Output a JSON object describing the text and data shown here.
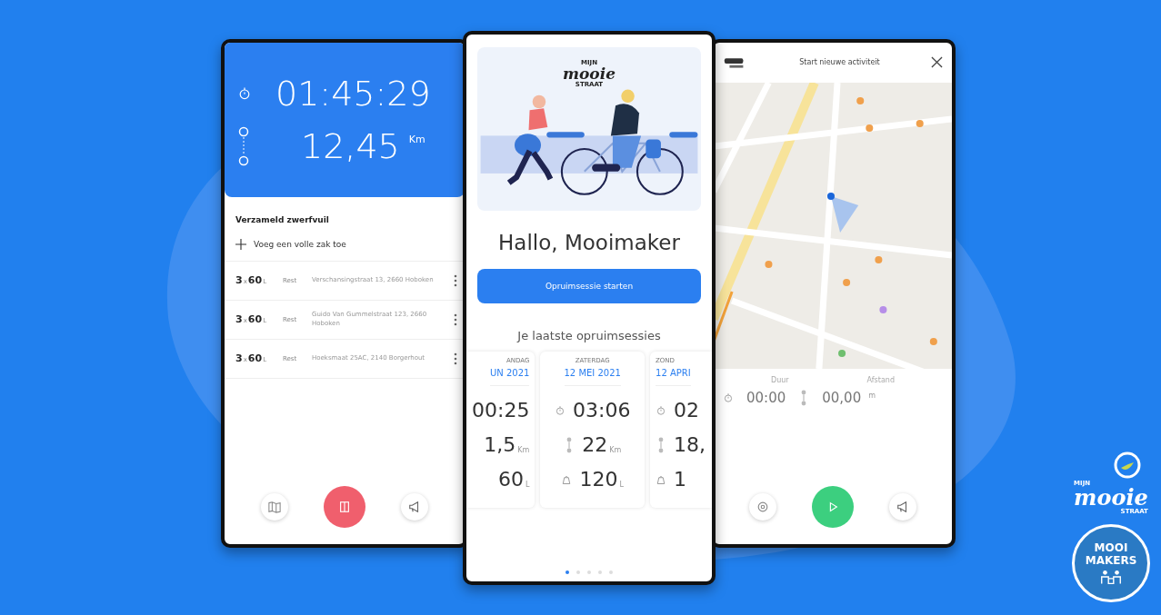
{
  "tracking_screen": {
    "duration": "01:45:29",
    "distance": "12,45",
    "distance_unit": "Km",
    "section_title": "Verzameld zwerfvuil",
    "add_label": "Voeg een volle zak toe",
    "bags": [
      {
        "count": "3",
        "times": "x",
        "volume": "60",
        "unit": "L",
        "type": "Rest",
        "address": "Verschansingstraat 13, 2660 Hoboken"
      },
      {
        "count": "3",
        "times": "x",
        "volume": "60",
        "unit": "L",
        "type": "Rest",
        "address": "Guido Van Gummelstraat 123, 2660 Hoboken"
      },
      {
        "count": "3",
        "times": "x",
        "volume": "60",
        "unit": "L",
        "type": "Rest",
        "address": "Hoeksmaat 25AC, 2140 Borgerhout"
      }
    ]
  },
  "home_screen": {
    "logo": {
      "top": "MIJN",
      "main": "mooie",
      "bottom": "STRAAT"
    },
    "greeting": "Hallo, Mooimaker",
    "start_button": "Opruimsessie starten",
    "sessions_title": "Je laatste opruimsessies",
    "sessions": [
      {
        "weekday": "ANDAG",
        "date": "UN 2021",
        "duration": "00:25",
        "distance": "1,5",
        "distance_unit": "Km",
        "volume": "60",
        "volume_unit": "L"
      },
      {
        "weekday": "ZATERDAG",
        "date": "12 MEI 2021",
        "duration": "03:06",
        "distance": "22",
        "distance_unit": "Km",
        "volume": "120",
        "volume_unit": "L"
      },
      {
        "weekday": "ZOND",
        "date": "12 APRI",
        "duration": "02",
        "distance": "18,",
        "volume": "1"
      }
    ],
    "pages": [
      {
        "selected": true
      },
      {
        "selected": false
      },
      {
        "selected": false
      },
      {
        "selected": false
      },
      {
        "selected": false
      }
    ]
  },
  "activity_screen": {
    "title": "Start nieuwe activiteit",
    "duration_label": "Duur",
    "distance_label": "Afstand",
    "duration": "00:00",
    "distance": "00,00",
    "distance_unit": "m"
  },
  "brand_logo": {
    "top": "MIJN",
    "main": "mooie",
    "bottom": "STRAAT"
  },
  "badge_logo": {
    "line_1": "MOOI",
    "line_2": "MAKERS"
  }
}
